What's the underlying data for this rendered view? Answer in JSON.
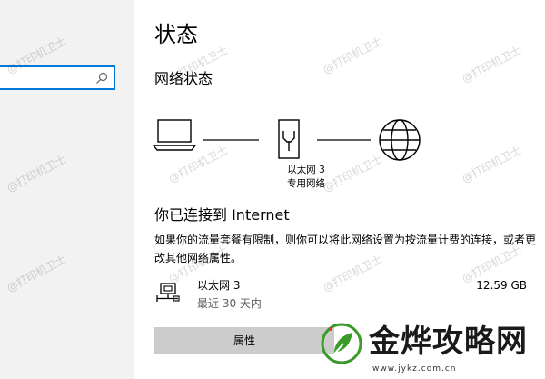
{
  "page": {
    "title": "状态",
    "network_status_heading": "网络状态"
  },
  "search": {
    "placeholder": ""
  },
  "diagram": {
    "adapter_name": "以太网 3",
    "adapter_type": "专用网络"
  },
  "connection": {
    "heading": "你已连接到 Internet",
    "metered_text": "如果你的流量套餐有限制，则你可以将此网络设置为按流量计费的连接，或者更改其他网络属性。"
  },
  "adapter_row": {
    "name": "以太网 3",
    "time": "最近 30 天内",
    "usage": "12.59 GB"
  },
  "buttons": {
    "properties": "属性"
  },
  "watermark": {
    "text": "@打印机卫士"
  },
  "logo": {
    "name": "金烨攻略网",
    "url": "www.jykz.com.cn"
  },
  "colors": {
    "sidebar_bg": "#f2f2f2",
    "accent": "#0078d7",
    "button_bg": "#cccccc",
    "logo_green": "#3a9a2a"
  }
}
